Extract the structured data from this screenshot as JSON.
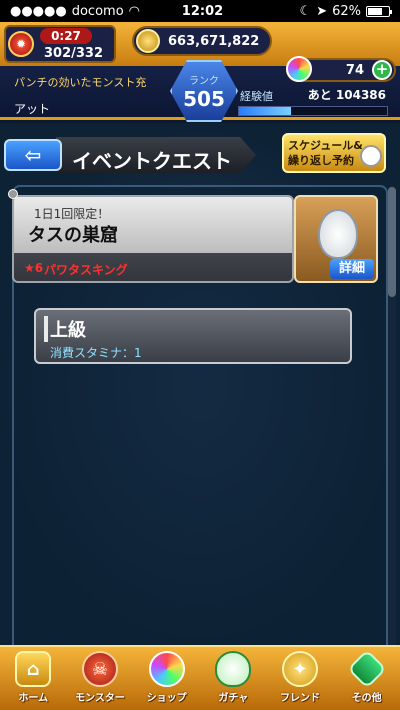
{
  "status": {
    "carrier": "docomo",
    "time": "12:02",
    "battery": "62%"
  },
  "hud": {
    "stamina_timer": "0:27",
    "stamina": "302/332",
    "gold": "663,671,822",
    "orbs": "74",
    "bonus_text": "パンチの効いたモンスト充",
    "user_name": "アット",
    "rank_label": "ランク",
    "rank": "505",
    "exp_label": "経験値",
    "exp_next": "あと 104386",
    "exp_progress": 0.35
  },
  "header": {
    "back": "⇦",
    "title": "イベントクエスト",
    "schedule_line1": "スケジュール&",
    "schedule_line2": "繰り返し予約"
  },
  "quest": {
    "limited": "1日1回限定！",
    "name": "タスの巣窟",
    "star": "★6",
    "subtitle": "パワタスキング",
    "detail": "詳細"
  },
  "level": {
    "name": "上級",
    "stamina": "消費スタミナ：1"
  },
  "nav": {
    "home": "ホーム",
    "monster": "モンスター",
    "shop": "ショップ",
    "gacha": "ガチャ",
    "friend": "フレンド",
    "other": "その他"
  }
}
